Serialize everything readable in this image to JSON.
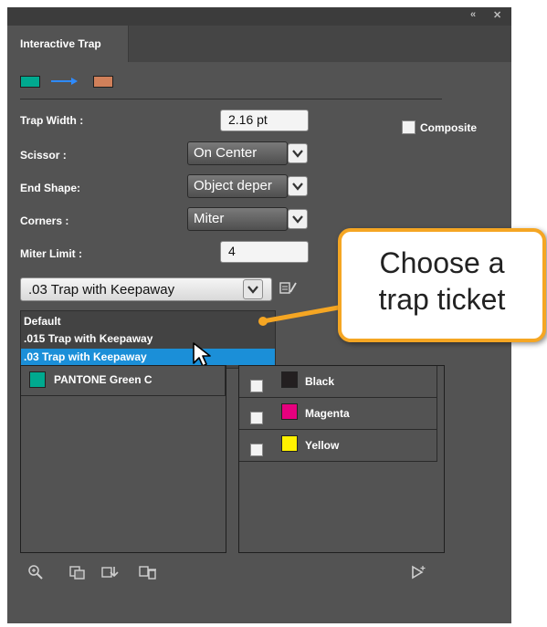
{
  "panel": {
    "tab_title": "Interactive Trap",
    "topbar_collapse": "«",
    "topbar_close": "✕",
    "trap_from_color": "#00a98f",
    "trap_to_color": "#d0805a"
  },
  "settings": {
    "trap_width_label": "Trap Width :",
    "trap_width_value": "2.16 pt",
    "scissor_label": "Scissor :",
    "scissor_value": "On Center",
    "end_shape_label": "End Shape:",
    "end_shape_value": "Object deper",
    "corners_label": "Corners :",
    "corners_value": "Miter",
    "miter_limit_label": "Miter Limit :",
    "miter_limit_value": "4",
    "composite_label": "Composite"
  },
  "ticket": {
    "selected": ".03 Trap with Keepaway",
    "options": [
      "Default",
      ".015 Trap with Keepaway",
      ".03 Trap with Keepaway"
    ],
    "highlighted_index": 2,
    "highlight_color": "#1b8fd8"
  },
  "left_list": {
    "items": [
      {
        "name": "PANTONE Green C",
        "color": "#00a98f"
      }
    ]
  },
  "right_list": {
    "items": [
      {
        "name": "Black",
        "color": "#231f20"
      },
      {
        "name": "Magenta",
        "color": "#e6007e"
      },
      {
        "name": "Yellow",
        "color": "#fff100"
      }
    ]
  },
  "callout": {
    "line1": "Choose a",
    "line2": "trap ticket",
    "border_color": "#f5a623"
  },
  "bottom_toolbar": {
    "icons": [
      "zoom-icon",
      "add-ink-icon",
      "import-icon",
      "delete-icon",
      "apply-icon"
    ]
  }
}
